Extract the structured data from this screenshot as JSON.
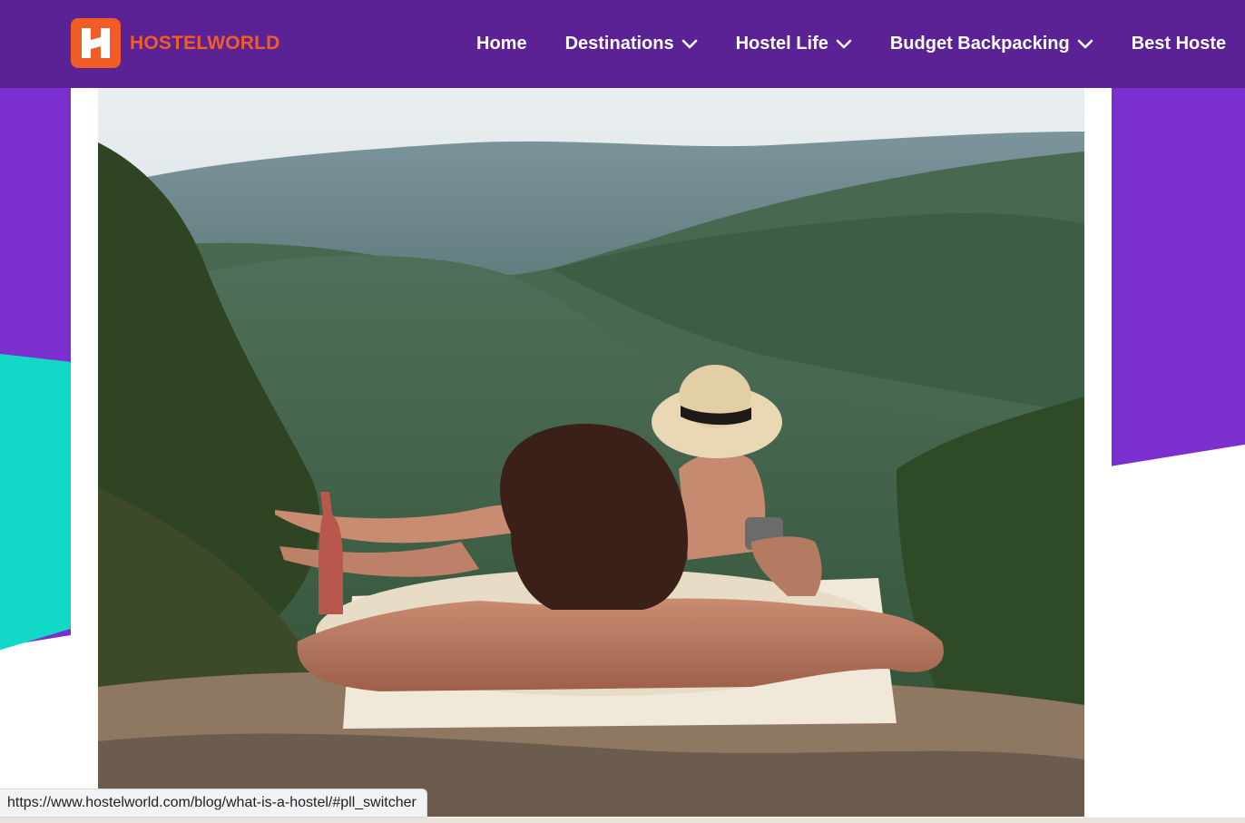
{
  "header": {
    "brand": "HOSTELWORLD",
    "logo_icon": "hostelworld-h-logo-icon",
    "colors": {
      "bar": "#5a2294",
      "brand": "#f25d27"
    },
    "nav": [
      {
        "label": "Home",
        "dropdown": false
      },
      {
        "label": "Destinations",
        "dropdown": true
      },
      {
        "label": "Hostel Life",
        "dropdown": true
      },
      {
        "label": "Budget Backpacking",
        "dropdown": true
      },
      {
        "label": "Best Hoste",
        "dropdown": false
      }
    ]
  },
  "main": {
    "image": "couple-in-bathtub-overlooking-mountain-valley-photo"
  },
  "status_bar": {
    "url": "https://www.hostelworld.com/blog/what-is-a-hostel/#pll_switcher"
  },
  "colors": {
    "background_purple": "#7b2fcf",
    "background_teal": "#12d8c8"
  }
}
